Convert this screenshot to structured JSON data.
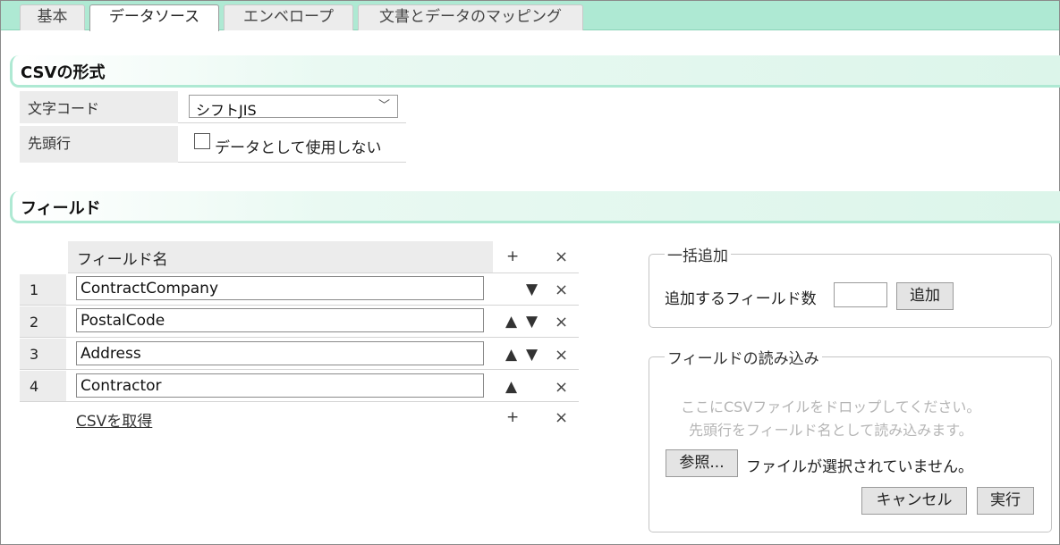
{
  "tabs": [
    "基本",
    "データソース",
    "エンベロープ",
    "文書とデータのマッピング"
  ],
  "csv_format": {
    "title": "CSVの形式",
    "encoding_label": "文字コード",
    "encoding_value": "シフトJIS",
    "header_label": "先頭行",
    "header_checkbox_label": "データとして使用しない"
  },
  "fields": {
    "title": "フィールド",
    "column_header": "フィールド名",
    "rows": [
      {
        "num": "1",
        "name": "ContractCompany"
      },
      {
        "num": "2",
        "name": "PostalCode"
      },
      {
        "num": "3",
        "name": "Address"
      },
      {
        "num": "4",
        "name": "Contractor"
      }
    ],
    "add_symbol": "+",
    "delete_symbol": "×",
    "up_symbol": "▲",
    "down_symbol": "▼",
    "get_csv_link": "CSVを取得"
  },
  "bulk_add": {
    "legend": "一括追加",
    "label": "追加するフィールド数",
    "value": "",
    "button": "追加"
  },
  "import": {
    "legend": "フィールドの読み込み",
    "drop_line1": "ここにCSVファイルをドロップしてください。",
    "drop_line2": "先頭行をフィールド名として読み込みます。",
    "browse_button": "参照...",
    "no_file_text": "ファイルが選択されていません。",
    "cancel_button": "キャンセル",
    "run_button": "実行"
  }
}
